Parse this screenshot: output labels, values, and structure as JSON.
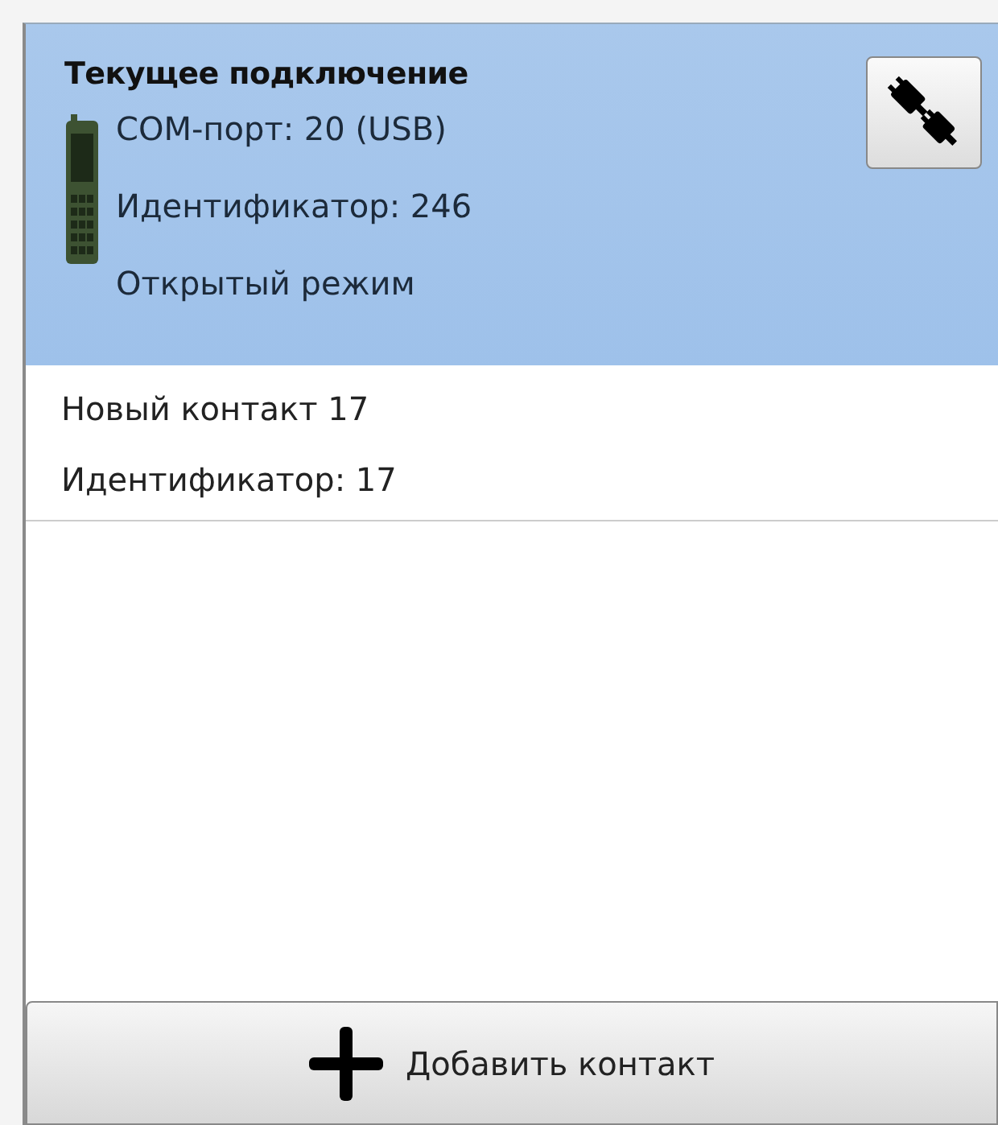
{
  "current_connection": {
    "title": "Текущее подключение",
    "lines": [
      "COM-порт: 20 (USB)",
      "Идентификатор: 246",
      "Открытый режим"
    ]
  },
  "contacts": [
    {
      "name": "Новый контакт 17",
      "identifier": "Идентификатор: 17",
      "selected": false
    }
  ],
  "add_button": {
    "label": "Добавить контакт"
  }
}
